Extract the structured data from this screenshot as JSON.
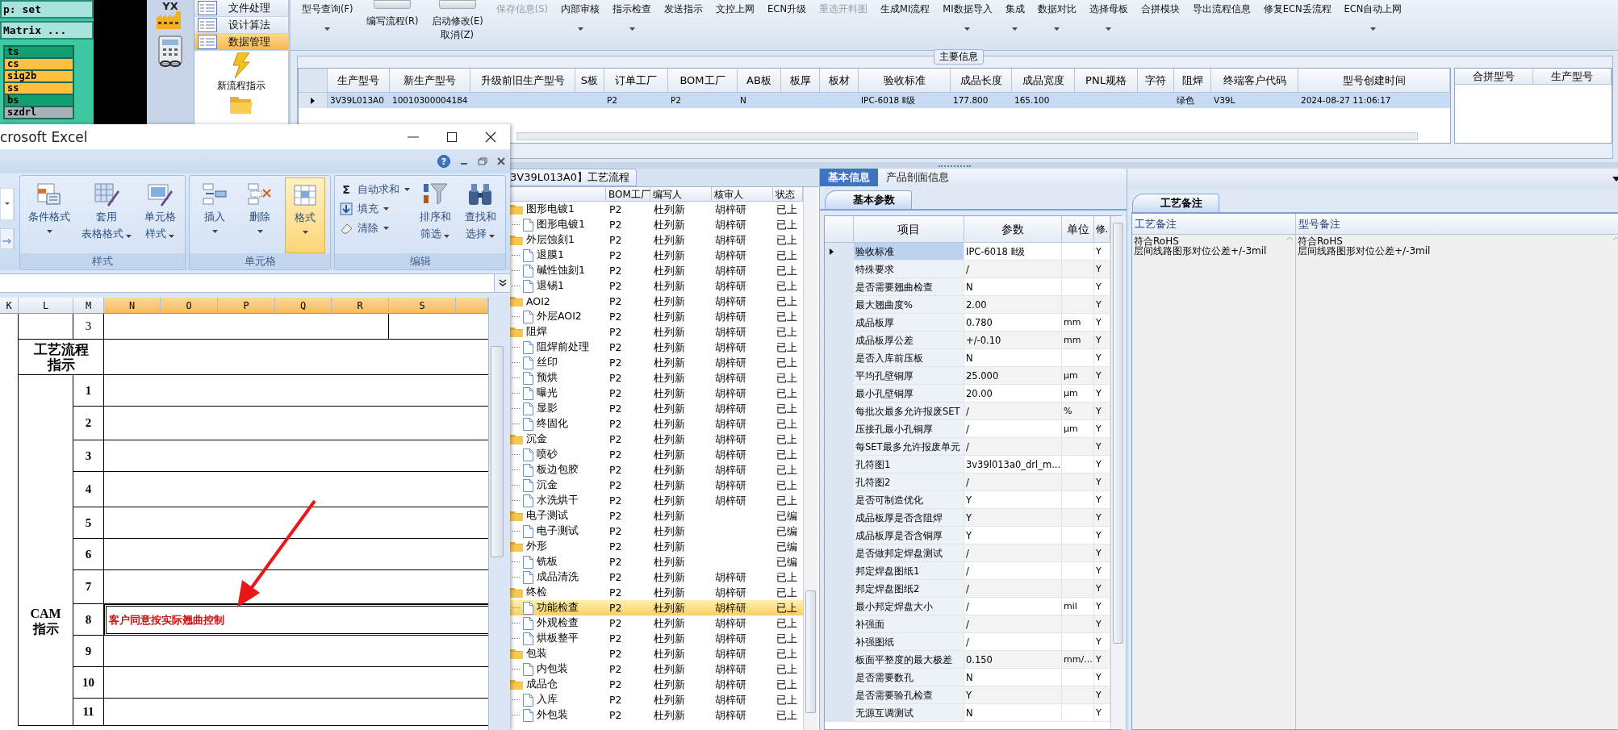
{
  "eda": {
    "lines": [
      "p: set",
      "Matrix ..."
    ],
    "layers": [
      {
        "name": "ts",
        "color": "#12a070"
      },
      {
        "name": "cs",
        "color": "#ffc040"
      },
      {
        "name": "sig2b",
        "color": "#ffc040"
      },
      {
        "name": "ss",
        "color": "#ffc040"
      },
      {
        "name": "bs",
        "color": "#12a070"
      },
      {
        "name": "szdrl",
        "color": "#a8b0b8"
      }
    ]
  },
  "nav": {
    "logo_text": "YX",
    "menu": [
      {
        "label": "文件处理",
        "selected": false
      },
      {
        "label": "设计算法",
        "selected": false
      },
      {
        "label": "数据管理",
        "selected": true
      }
    ],
    "action": "新流程指示"
  },
  "ribbon": [
    {
      "lines": [
        "型号查询(F)"
      ],
      "toggle": false,
      "dropdown": true,
      "disabled": false
    },
    {
      "lines": [
        "编写流程(R)"
      ],
      "toggle": true,
      "on": false,
      "dropdown": false,
      "disabled": false
    },
    {
      "lines": [
        "启动修改(E)",
        "取消(Z)"
      ],
      "toggle": true,
      "on": false,
      "dropdown": false,
      "disabled": false
    },
    {
      "lines": [
        "保存信息(S)"
      ],
      "toggle": false,
      "dropdown": false,
      "disabled": true
    },
    {
      "lines": [
        "内部审核"
      ],
      "toggle": false,
      "dropdown": true,
      "disabled": false
    },
    {
      "lines": [
        "指示检查"
      ],
      "toggle": false,
      "dropdown": true,
      "disabled": false
    },
    {
      "lines": [
        "发送指示"
      ],
      "toggle": false,
      "dropdown": false,
      "disabled": false
    },
    {
      "lines": [
        "文控上网"
      ],
      "toggle": false,
      "dropdown": false,
      "disabled": false
    },
    {
      "lines": [
        "ECN升级"
      ],
      "toggle": false,
      "dropdown": false,
      "disabled": false
    },
    {
      "lines": [
        "重选开料图"
      ],
      "toggle": false,
      "dropdown": false,
      "disabled": true
    },
    {
      "lines": [
        "生成MI流程"
      ],
      "toggle": false,
      "dropdown": false,
      "disabled": false
    },
    {
      "lines": [
        "MI数据导入"
      ],
      "toggle": false,
      "dropdown": true,
      "disabled": false
    },
    {
      "lines": [
        "集成"
      ],
      "toggle": false,
      "dropdown": true,
      "disabled": false
    },
    {
      "lines": [
        "数据对比"
      ],
      "toggle": false,
      "dropdown": true,
      "disabled": false
    },
    {
      "lines": [
        "选择母板"
      ],
      "toggle": false,
      "dropdown": true,
      "disabled": false
    },
    {
      "lines": [
        "合拼模块"
      ],
      "toggle": false,
      "dropdown": false,
      "disabled": false
    },
    {
      "lines": [
        "导出流程信息"
      ],
      "toggle": false,
      "dropdown": false,
      "disabled": false
    },
    {
      "lines": [
        "修复ECN丢流程"
      ],
      "toggle": false,
      "dropdown": false,
      "disabled": false
    },
    {
      "lines": [
        "ECN自动上网"
      ],
      "toggle": false,
      "dropdown": true,
      "disabled": false
    }
  ],
  "main_info": {
    "title": "主要信息",
    "columns": [
      "生产型号",
      "新生产型号",
      "升级前旧生产型号",
      "S板",
      "订单工厂",
      "BOM工厂",
      "AB板",
      "板厚",
      "板材",
      "验收标准",
      "成品长度",
      "成品宽度",
      "PNL规格",
      "字符",
      "阻焊",
      "终端客户代码",
      "型号创建时间"
    ],
    "rows": [
      {
        "selected": true,
        "cells": [
          "3V39L013A0",
          "10010300004184",
          "",
          "",
          "P2",
          "P2",
          "N",
          "",
          "",
          "IPC-6018 Ⅱ级",
          "177.800",
          "165.100",
          "",
          "",
          "绿色",
          "V39L",
          "2024-08-27 11:06:17"
        ]
      }
    ],
    "side_columns": [
      "合拼型号",
      "生产型号"
    ]
  },
  "tree": {
    "title": "3V39L013A0】工艺流程",
    "columns": [
      "BOM工厂",
      "编写人",
      "核审人",
      "状态"
    ],
    "nodes": [
      {
        "name": "图形电镀1",
        "bom": "P2",
        "writer": "杜列新",
        "reviewer": "胡梓研",
        "status": "已上",
        "selected": false,
        "children": [
          {
            "name": "图形电镀1",
            "bom": "P2",
            "writer": "杜列新",
            "reviewer": "胡梓研",
            "status": "已上",
            "selected": false
          }
        ]
      },
      {
        "name": "外层蚀刻1",
        "bom": "P2",
        "writer": "杜列新",
        "reviewer": "胡梓研",
        "status": "已上",
        "selected": false,
        "children": [
          {
            "name": "退膜1",
            "bom": "P2",
            "writer": "杜列新",
            "reviewer": "胡梓研",
            "status": "已上",
            "selected": false
          },
          {
            "name": "碱性蚀刻1",
            "bom": "P2",
            "writer": "杜列新",
            "reviewer": "胡梓研",
            "status": "已上",
            "selected": false
          },
          {
            "name": "退锡1",
            "bom": "P2",
            "writer": "杜列新",
            "reviewer": "胡梓研",
            "status": "已上",
            "selected": false
          }
        ]
      },
      {
        "name": "AOI2",
        "bom": "P2",
        "writer": "杜列新",
        "reviewer": "胡梓研",
        "status": "已上",
        "selected": false,
        "children": [
          {
            "name": "外层AOI2",
            "bom": "P2",
            "writer": "杜列新",
            "reviewer": "胡梓研",
            "status": "已上",
            "selected": false
          }
        ]
      },
      {
        "name": "阻焊",
        "bom": "P2",
        "writer": "杜列新",
        "reviewer": "胡梓研",
        "status": "已上",
        "selected": false,
        "children": [
          {
            "name": "阻焊前处理",
            "bom": "P2",
            "writer": "杜列新",
            "reviewer": "胡梓研",
            "status": "已上",
            "selected": false
          },
          {
            "name": "丝印",
            "bom": "P2",
            "writer": "杜列新",
            "reviewer": "胡梓研",
            "status": "已上",
            "selected": false
          },
          {
            "name": "预烘",
            "bom": "P2",
            "writer": "杜列新",
            "reviewer": "胡梓研",
            "status": "已上",
            "selected": false
          },
          {
            "name": "曝光",
            "bom": "P2",
            "writer": "杜列新",
            "reviewer": "胡梓研",
            "status": "已上",
            "selected": false
          },
          {
            "name": "显影",
            "bom": "P2",
            "writer": "杜列新",
            "reviewer": "胡梓研",
            "status": "已上",
            "selected": false
          },
          {
            "name": "终固化",
            "bom": "P2",
            "writer": "杜列新",
            "reviewer": "胡梓研",
            "status": "已上",
            "selected": false
          }
        ]
      },
      {
        "name": "沉金",
        "bom": "P2",
        "writer": "杜列新",
        "reviewer": "胡梓研",
        "status": "已上",
        "selected": false,
        "children": [
          {
            "name": "喷砂",
            "bom": "P2",
            "writer": "杜列新",
            "reviewer": "胡梓研",
            "status": "已上",
            "selected": false
          },
          {
            "name": "板边包胶",
            "bom": "P2",
            "writer": "杜列新",
            "reviewer": "胡梓研",
            "status": "已上",
            "selected": false
          },
          {
            "name": "沉金",
            "bom": "P2",
            "writer": "杜列新",
            "reviewer": "胡梓研",
            "status": "已上",
            "selected": false
          },
          {
            "name": "水洗烘干",
            "bom": "P2",
            "writer": "杜列新",
            "reviewer": "胡梓研",
            "status": "已上",
            "selected": false
          }
        ]
      },
      {
        "name": "电子测试",
        "bom": "P2",
        "writer": "杜列新",
        "status": "已编",
        "selected": false,
        "children": [
          {
            "name": "电子测试",
            "bom": "P2",
            "writer": "杜列新",
            "status": "已编",
            "selected": false
          }
        ]
      },
      {
        "name": "外形",
        "bom": "P2",
        "writer": "杜列新",
        "status": "已编",
        "selected": false,
        "children": [
          {
            "name": "铣板",
            "bom": "P2",
            "writer": "杜列新",
            "status": "已编",
            "selected": false
          },
          {
            "name": "成品清洗",
            "bom": "P2",
            "writer": "杜列新",
            "reviewer": "胡梓研",
            "status": "已上",
            "selected": false
          }
        ]
      },
      {
        "name": "终检",
        "bom": "P2",
        "writer": "杜列新",
        "reviewer": "胡梓研",
        "status": "已上",
        "selected": false,
        "children": [
          {
            "name": "功能检查",
            "bom": "P2",
            "writer": "杜列新",
            "reviewer": "胡梓研",
            "status": "已上",
            "selected": true
          },
          {
            "name": "外观检查",
            "bom": "P2",
            "writer": "杜列新",
            "reviewer": "胡梓研",
            "status": "已上",
            "selected": false
          },
          {
            "name": "烘板整平",
            "bom": "P2",
            "writer": "杜列新",
            "reviewer": "胡梓研",
            "status": "已上",
            "selected": false
          }
        ]
      },
      {
        "name": "包装",
        "bom": "P2",
        "writer": "杜列新",
        "reviewer": "胡梓研",
        "status": "已上",
        "selected": false,
        "children": [
          {
            "name": "内包装",
            "bom": "P2",
            "writer": "杜列新",
            "reviewer": "胡梓研",
            "status": "已上",
            "selected": false
          }
        ]
      },
      {
        "name": "成品仓",
        "bom": "P2",
        "writer": "杜列新",
        "reviewer": "胡梓研",
        "status": "已上",
        "selected": false,
        "children": [
          {
            "name": "入库",
            "bom": "P2",
            "writer": "杜列新",
            "reviewer": "胡梓研",
            "status": "已上",
            "selected": false
          },
          {
            "name": "外包装",
            "bom": "P2",
            "writer": "杜列新",
            "reviewer": "胡梓研",
            "status": "已上",
            "selected": false
          }
        ]
      }
    ]
  },
  "basic": {
    "tabs": [
      {
        "label": "基本信息",
        "selected": true
      },
      {
        "label": "产品剖面信息",
        "selected": false
      }
    ],
    "subtab": "基本参数",
    "columns": [
      "项目",
      "参数",
      "单位",
      "修."
    ],
    "rows": [
      {
        "item": "验收标准",
        "param": "IPC-6018 Ⅱ级",
        "flag": "Y",
        "selected": true
      },
      {
        "item": "特殊要求",
        "param": "/",
        "flag": "Y",
        "selected": false
      },
      {
        "item": "是否需要翘曲检查",
        "param": "N",
        "flag": "Y",
        "selected": false
      },
      {
        "item": "最大翘曲度%",
        "param": "2.00",
        "flag": "Y",
        "selected": false
      },
      {
        "item": "成品板厚",
        "param": "0.780",
        "unit": "mm",
        "flag": "Y",
        "selected": false
      },
      {
        "item": "成品板厚公差",
        "param": "+/-0.10",
        "unit": "mm",
        "flag": "Y",
        "selected": false
      },
      {
        "item": "是否入库前压板",
        "param": "N",
        "flag": "Y",
        "selected": false
      },
      {
        "item": "平均孔壁铜厚",
        "param": "25.000",
        "unit": "μm",
        "flag": "Y",
        "selected": false
      },
      {
        "item": "最小孔壁铜厚",
        "param": "20.00",
        "unit": "μm",
        "flag": "Y",
        "selected": false
      },
      {
        "item": "每批次最多允许报废SET",
        "param": "/",
        "unit": "%",
        "flag": "Y",
        "selected": false
      },
      {
        "item": "压接孔最小孔铜厚",
        "param": "/",
        "unit": "μm",
        "flag": "Y",
        "selected": false
      },
      {
        "item": "每SET最多允许报废单元",
        "param": "/",
        "flag": "Y",
        "selected": false
      },
      {
        "item": "孔符图1",
        "param": "3v39l013a0_drl_m...",
        "flag": "Y",
        "selected": false
      },
      {
        "item": "孔符图2",
        "param": "/",
        "flag": "Y",
        "selected": false
      },
      {
        "item": "是否可制造优化",
        "param": "Y",
        "flag": "Y",
        "selected": false
      },
      {
        "item": "成品板厚是否含阻焊",
        "param": "Y",
        "flag": "Y",
        "selected": false
      },
      {
        "item": "成品板厚是否含铜厚",
        "param": "Y",
        "flag": "Y",
        "selected": false
      },
      {
        "item": "是否做邦定焊盘测试",
        "param": "/",
        "flag": "Y",
        "selected": false
      },
      {
        "item": "邦定焊盘图纸1",
        "param": "/",
        "flag": "Y",
        "selected": false
      },
      {
        "item": "邦定焊盘图纸2",
        "param": "/",
        "flag": "Y",
        "selected": false
      },
      {
        "item": "最小邦定焊盘大小",
        "param": "/",
        "unit": "mil",
        "flag": "Y",
        "selected": false
      },
      {
        "item": "补强面",
        "param": "/",
        "flag": "Y",
        "selected": false
      },
      {
        "item": "补强图纸",
        "param": "/",
        "flag": "Y",
        "selected": false
      },
      {
        "item": "板面平整度的最大极差",
        "param": "0.150",
        "unit": "mm/...",
        "flag": "Y",
        "selected": false
      },
      {
        "item": "是否需要数孔",
        "param": "N",
        "flag": "Y",
        "selected": false
      },
      {
        "item": "是否需要验孔检查",
        "param": "Y",
        "flag": "Y",
        "selected": false
      },
      {
        "item": "无源互调测试",
        "param": "N",
        "flag": "Y",
        "selected": false
      }
    ]
  },
  "notes": {
    "tab": "工艺备注",
    "columns": [
      "工艺备注",
      "型号备注"
    ],
    "values": [
      "符合RoHS\n层间线路图形对位公差+/-3mil",
      "符合RoHS\n层间线路图形对位公差+/-3mil"
    ]
  },
  "excel": {
    "title": "crosoft Excel",
    "help": "?",
    "groups": [
      {
        "label": "样式",
        "items": [
          {
            "kind": "large",
            "lines": [
              "条件格式"
            ],
            "dropdown": true,
            "selected": false
          },
          {
            "kind": "large",
            "lines": [
              "套用",
              "表格格式"
            ],
            "dropdown": true,
            "selected": false
          },
          {
            "kind": "large",
            "lines": [
              "单元格",
              "样式"
            ],
            "dropdown": true,
            "selected": false
          }
        ]
      },
      {
        "label": "单元格",
        "items": [
          {
            "kind": "large",
            "lines": [
              "插入"
            ],
            "dropdown": true,
            "selected": false
          },
          {
            "kind": "large",
            "lines": [
              "删除"
            ],
            "dropdown": true,
            "selected": false
          },
          {
            "kind": "large",
            "lines": [
              "格式"
            ],
            "dropdown": true,
            "selected": true
          }
        ]
      },
      {
        "label": "编辑",
        "items": [
          {
            "kind": "small",
            "symbol": "Σ",
            "lines": [
              "自动求和"
            ],
            "dropdown": true,
            "selected": false
          },
          {
            "kind": "small",
            "lines": [
              "填充"
            ],
            "dropdown": true,
            "selected": false
          },
          {
            "kind": "small",
            "lines": [
              "清除"
            ],
            "dropdown": true,
            "selected": false
          },
          {
            "kind": "large",
            "lines": [
              "排序和",
              "筛选"
            ],
            "dropdown": true,
            "selected": false
          },
          {
            "kind": "large",
            "lines": [
              "查找和",
              "选择"
            ],
            "dropdown": true,
            "selected": false
          }
        ]
      }
    ],
    "sheet": {
      "columns": [
        {
          "label": "K",
          "selected": false
        },
        {
          "label": "L",
          "selected": false
        },
        {
          "label": "M",
          "selected": false
        },
        {
          "label": "N",
          "selected": true
        },
        {
          "label": "O",
          "selected": true
        },
        {
          "label": "P",
          "selected": true
        },
        {
          "label": "Q",
          "selected": true
        },
        {
          "label": "R",
          "selected": true
        },
        {
          "label": "S",
          "selected": true
        }
      ],
      "top_number": "3",
      "section": "工艺流程指示",
      "group_label": "CAM指示",
      "rows": [
        {
          "number": "1",
          "selected": false
        },
        {
          "number": "2",
          "selected": false
        },
        {
          "number": "3",
          "selected": false
        },
        {
          "number": "4",
          "selected": false
        },
        {
          "number": "5",
          "selected": false
        },
        {
          "number": "6",
          "selected": false
        },
        {
          "number": "7",
          "selected": false
        },
        {
          "number": "8",
          "text": "客户同意按实际翘曲控制",
          "selected": true
        },
        {
          "number": "9",
          "selected": false
        },
        {
          "number": "10",
          "selected": false
        },
        {
          "number": "11",
          "selected": false
        }
      ]
    }
  }
}
